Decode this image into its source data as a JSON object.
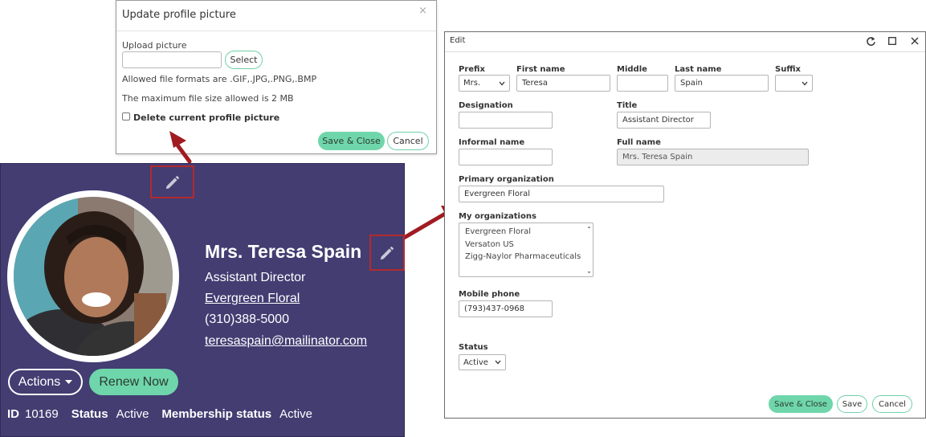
{
  "upload_dialog": {
    "title": "Update profile picture",
    "close_glyph": "×",
    "upload_label": "Upload picture",
    "file_value": "",
    "select_label": "Select",
    "formats_text": "Allowed file formats are .GIF,.JPG,.PNG,.BMP",
    "max_size_text": "The maximum file size allowed is 2 MB",
    "delete_label": "Delete current profile picture",
    "delete_checked": false,
    "save_close_label": "Save & Close",
    "cancel_label": "Cancel"
  },
  "profile": {
    "name": "Mrs. Teresa Spain",
    "title": "Assistant Director",
    "organization": "Evergreen Floral",
    "phone": "(310)388-5000",
    "email": "teresaspain@mailinator.com",
    "actions_label": "Actions",
    "renew_label": "Renew Now",
    "id_label": "ID",
    "id_value": "10169",
    "status_label": "Status",
    "status_value": "Active",
    "membership_label": "Membership status",
    "membership_value": "Active",
    "icons": {
      "edit_photo": "pencil-icon",
      "edit_profile": "pencil-icon",
      "actions_caret": "caret-down-icon"
    }
  },
  "edit_dialog": {
    "title": "Edit",
    "controls": {
      "refresh": "refresh-icon",
      "maximize": "maximize-icon",
      "close": "close-icon"
    },
    "fields": {
      "prefix": {
        "label": "Prefix",
        "value": "Mrs."
      },
      "first_name": {
        "label": "First name",
        "value": "Teresa"
      },
      "middle": {
        "label": "Middle",
        "value": ""
      },
      "last_name": {
        "label": "Last name",
        "value": "Spain"
      },
      "suffix": {
        "label": "Suffix",
        "value": ""
      },
      "designation": {
        "label": "Designation",
        "value": ""
      },
      "title": {
        "label": "Title",
        "value": "Assistant Director"
      },
      "informal_name": {
        "label": "Informal name",
        "value": ""
      },
      "full_name": {
        "label": "Full name",
        "value": "Mrs. Teresa Spain"
      },
      "primary_org": {
        "label": "Primary organization",
        "value": "Evergreen Floral"
      },
      "my_orgs": {
        "label": "My organizations",
        "items": [
          "Evergreen Floral",
          "Versaton US",
          "Zigg-Naylor Pharmaceuticals"
        ]
      },
      "mobile_phone": {
        "label": "Mobile phone",
        "value": "(793)437-0968"
      },
      "status": {
        "label": "Status",
        "value": "Active"
      }
    },
    "buttons": {
      "save_close": "Save & Close",
      "save": "Save",
      "cancel": "Cancel"
    }
  },
  "colors": {
    "card_bg": "#433d72",
    "accent_green": "#6fd6ab",
    "annotation_red": "#b22a2e"
  }
}
